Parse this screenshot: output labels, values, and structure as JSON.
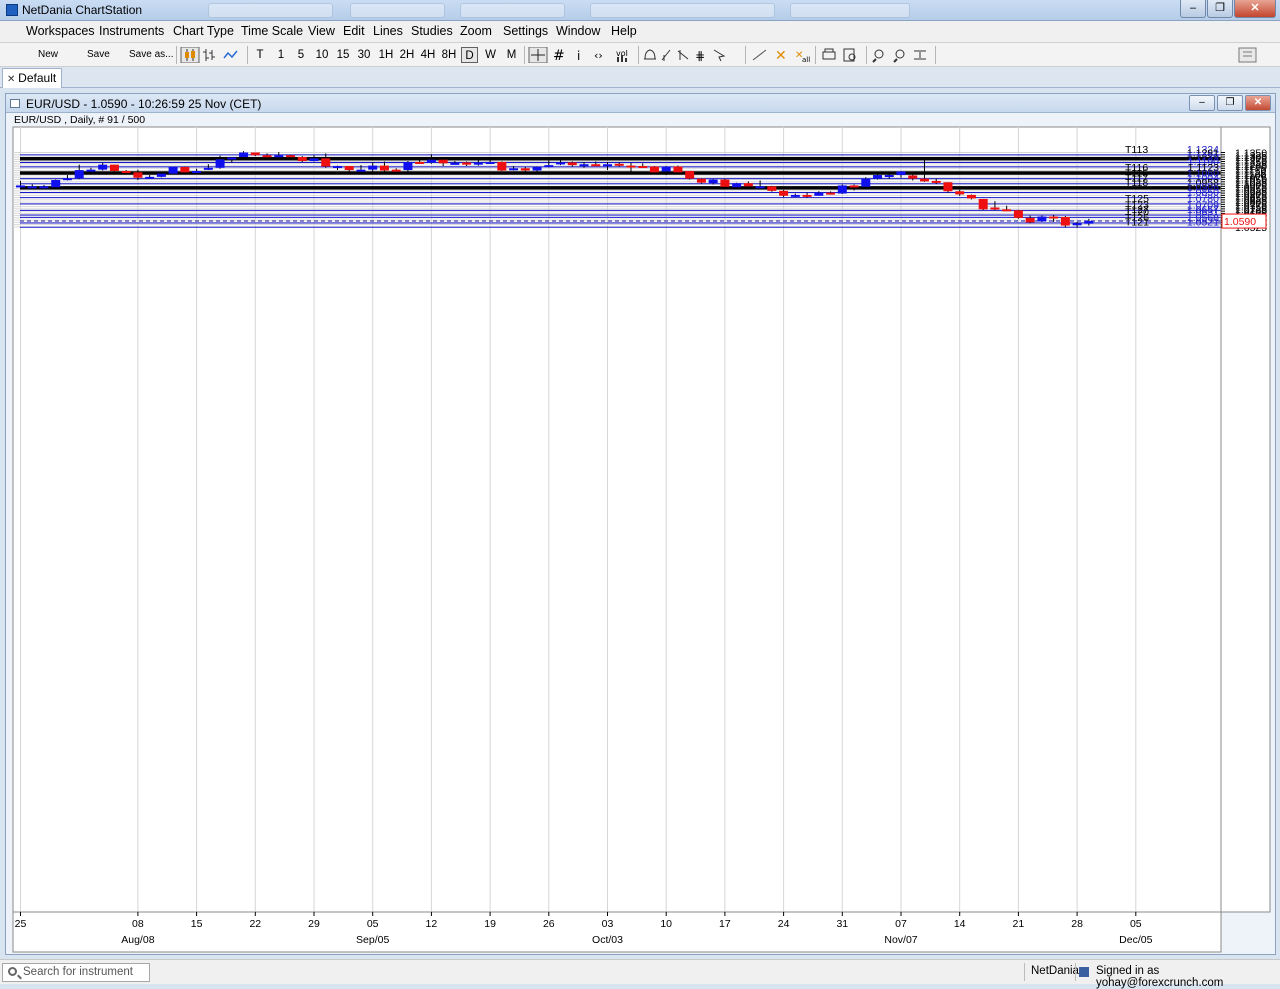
{
  "window": {
    "title": "NetDania ChartStation",
    "controls": [
      "–",
      "❐",
      "✕"
    ]
  },
  "menu": [
    "Workspaces",
    "Instruments",
    "Chart Type",
    "Time Scale",
    "View",
    "Edit",
    "Lines",
    "Studies",
    "Zoom",
    "Settings",
    "Window",
    "Help"
  ],
  "toolbar": {
    "new": "New",
    "save": "Save",
    "save_as": "Save as...",
    "timeframes": [
      "T",
      "1",
      "5",
      "10",
      "15",
      "30",
      "1H",
      "2H",
      "4H",
      "8H",
      "D",
      "W",
      "M"
    ],
    "selected_timeframe": "D",
    "vol_label": "vol"
  },
  "tab": {
    "label": "Default"
  },
  "chart_window": {
    "title": "EUR/USD - 1.0590 - 10:26:59  25 Nov (CET)",
    "subtitle": "EUR/USD , Daily, # 91 / 500"
  },
  "status": {
    "search_placeholder": "Search for instrument",
    "provider": "NetDania",
    "signed_in": "Signed in as yohay@forexcrunch.com"
  },
  "chart_data": {
    "type": "candlestick",
    "instrument": "EUR/USD",
    "timeframe": "Daily",
    "ylim": [
      1.051,
      1.137
    ],
    "y_ticks": [
      "1.1350",
      "1.1325",
      "1.1300",
      "1.1275",
      "1.1250",
      "1.1225",
      "1.1200",
      "1.1175",
      "1.1150",
      "1.1125",
      "1.1100",
      "1.1075",
      "1.1050",
      "1.1025",
      "1.1000",
      "1.0975",
      "1.0950",
      "1.0925",
      "1.0900",
      "1.0875",
      "1.0850",
      "1.0825",
      "1.0800",
      "1.0775",
      "1.0750",
      "1.0725",
      "1.0700",
      "1.0675",
      "1.0650",
      "1.0625",
      "1.0600",
      "1.0575",
      "1.0550",
      "1.0525"
    ],
    "x_ticks": [
      {
        "label": "25",
        "sub": "",
        "index": 0
      },
      {
        "label": "08",
        "sub": "Aug/08",
        "index": 10
      },
      {
        "label": "15",
        "sub": "",
        "index": 15
      },
      {
        "label": "22",
        "sub": "",
        "index": 20
      },
      {
        "label": "29",
        "sub": "",
        "index": 25
      },
      {
        "label": "05",
        "sub": "Sep/05",
        "index": 30
      },
      {
        "label": "12",
        "sub": "",
        "index": 35
      },
      {
        "label": "19",
        "sub": "",
        "index": 40
      },
      {
        "label": "26",
        "sub": "",
        "index": 45
      },
      {
        "label": "03",
        "sub": "Oct/03",
        "index": 50
      },
      {
        "label": "10",
        "sub": "",
        "index": 55
      },
      {
        "label": "17",
        "sub": "",
        "index": 60
      },
      {
        "label": "24",
        "sub": "",
        "index": 65
      },
      {
        "label": "31",
        "sub": "",
        "index": 70
      },
      {
        "label": "07",
        "sub": "Nov/07",
        "index": 75
      },
      {
        "label": "14",
        "sub": "",
        "index": 80
      },
      {
        "label": "21",
        "sub": "",
        "index": 85
      },
      {
        "label": "28",
        "sub": "",
        "index": 90
      },
      {
        "label": "05",
        "sub": "Dec/05",
        "index": 95
      }
    ],
    "last_price": "1.0590",
    "colors": {
      "up": "#1010ee",
      "down": "#ee1010",
      "level": "#1a1acc",
      "thick": "#000000"
    },
    "levels": [
      {
        "tag": "T113",
        "value": "1.1324",
        "thick": false
      },
      {
        "tag": "",
        "value": "1.1281",
        "thick": true
      },
      {
        "tag": "",
        "value": "1.1239",
        "thick": false
      },
      {
        "tag": "",
        "value": "1.1190",
        "thick": false
      },
      {
        "tag": "T116",
        "value": "1.1123",
        "thick": true
      },
      {
        "tag": "T115",
        "value": "1.1060",
        "thick": false
      },
      {
        "tag": "T117",
        "value": "1.1004",
        "thick": false
      },
      {
        "tag": "T118",
        "value": "1.0958",
        "thick": true
      },
      {
        "tag": "",
        "value": "1.0906",
        "thick": false
      },
      {
        "tag": "",
        "value": "1.0850",
        "thick": false
      },
      {
        "tag": "T125",
        "value": "1.0780",
        "thick": false
      },
      {
        "tag": "T123",
        "value": "1.0709",
        "thick": false
      },
      {
        "tag": "T127",
        "value": "1.0657",
        "thick": false
      },
      {
        "tag": "T120",
        "value": "1.0631",
        "thick": false
      },
      {
        "tag": "T126",
        "value": "1.0568",
        "thick": false
      },
      {
        "tag": "T121",
        "value": "1.0521",
        "thick": false
      }
    ],
    "candles": [
      [
        1.0975,
        1.0985,
        1.0955,
        1.1035
      ],
      [
        1.0955,
        1.0975,
        1.095,
        1.0998
      ],
      [
        1.097,
        1.0975,
        1.0965,
        1.099
      ],
      [
        1.0965,
        1.1045,
        1.0955,
        1.105
      ],
      [
        1.105,
        1.1065,
        1.104,
        1.11
      ],
      [
        1.1065,
        1.1155,
        1.1055,
        1.1215
      ],
      [
        1.116,
        1.116,
        1.115,
        1.118
      ],
      [
        1.116,
        1.1215,
        1.115,
        1.1235
      ],
      [
        1.1215,
        1.1145,
        1.114,
        1.1215
      ],
      [
        1.1145,
        1.113,
        1.111,
        1.1155
      ],
      [
        1.113,
        1.107,
        1.1045,
        1.116
      ],
      [
        1.108,
        1.108,
        1.1065,
        1.11
      ],
      [
        1.108,
        1.1115,
        1.1075,
        1.113
      ],
      [
        1.1115,
        1.119,
        1.111,
        1.119
      ],
      [
        1.119,
        1.113,
        1.112,
        1.1195
      ],
      [
        1.1135,
        1.1145,
        1.1125,
        1.117
      ],
      [
        1.116,
        1.118,
        1.1155,
        1.122
      ],
      [
        1.118,
        1.1275,
        1.117,
        1.1315
      ],
      [
        1.1275,
        1.1295,
        1.124,
        1.1295
      ],
      [
        1.13,
        1.135,
        1.1295,
        1.1365
      ],
      [
        1.135,
        1.132,
        1.131,
        1.135
      ],
      [
        1.132,
        1.13,
        1.127,
        1.134
      ],
      [
        1.1305,
        1.132,
        1.1295,
        1.1355
      ],
      [
        1.132,
        1.13,
        1.1295,
        1.1325
      ],
      [
        1.13,
        1.1255,
        1.1245,
        1.131
      ],
      [
        1.1255,
        1.1285,
        1.125,
        1.132
      ],
      [
        1.1285,
        1.1195,
        1.118,
        1.134
      ],
      [
        1.1195,
        1.12,
        1.1155,
        1.1205
      ],
      [
        1.12,
        1.1155,
        1.113,
        1.12
      ],
      [
        1.115,
        1.116,
        1.1125,
        1.121
      ],
      [
        1.116,
        1.1205,
        1.113,
        1.1245
      ],
      [
        1.1205,
        1.115,
        1.1135,
        1.125
      ],
      [
        1.116,
        1.1155,
        1.1145,
        1.1175
      ],
      [
        1.1155,
        1.1245,
        1.114,
        1.1255
      ],
      [
        1.1245,
        1.124,
        1.123,
        1.1275
      ],
      [
        1.1235,
        1.127,
        1.1225,
        1.133
      ],
      [
        1.127,
        1.123,
        1.12,
        1.1285
      ],
      [
        1.123,
        1.1235,
        1.1225,
        1.1255
      ],
      [
        1.124,
        1.1215,
        1.12,
        1.125
      ],
      [
        1.1215,
        1.124,
        1.1205,
        1.1275
      ],
      [
        1.124,
        1.1245,
        1.1235,
        1.1285
      ],
      [
        1.1245,
        1.115,
        1.1145,
        1.125
      ],
      [
        1.1155,
        1.1175,
        1.115,
        1.12
      ],
      [
        1.1175,
        1.115,
        1.114,
        1.119
      ],
      [
        1.115,
        1.119,
        1.1125,
        1.1195
      ],
      [
        1.119,
        1.121,
        1.1185,
        1.126
      ],
      [
        1.1225,
        1.124,
        1.121,
        1.1285
      ],
      [
        1.124,
        1.121,
        1.1195,
        1.125
      ],
      [
        1.121,
        1.122,
        1.118,
        1.1245
      ],
      [
        1.122,
        1.1215,
        1.12,
        1.125
      ],
      [
        1.1215,
        1.122,
        1.1155,
        1.1245
      ],
      [
        1.1225,
        1.1205,
        1.1195,
        1.124
      ],
      [
        1.1205,
        1.12,
        1.1135,
        1.1235
      ],
      [
        1.12,
        1.1195,
        1.1195,
        1.123
      ],
      [
        1.1195,
        1.113,
        1.1115,
        1.12
      ],
      [
        1.114,
        1.1195,
        1.11,
        1.12
      ],
      [
        1.1195,
        1.113,
        1.1125,
        1.1205
      ],
      [
        1.1145,
        1.106,
        1.105,
        1.1145
      ],
      [
        1.106,
        1.1015,
        1.1005,
        1.1065
      ],
      [
        1.101,
        1.105,
        1.0995,
        1.1055
      ],
      [
        1.105,
        1.097,
        1.0965,
        1.106
      ],
      [
        1.0965,
        1.101,
        1.0965,
        1.1015
      ],
      [
        1.101,
        1.0975,
        1.097,
        1.103
      ],
      [
        1.0975,
        1.0975,
        1.0955,
        1.104
      ],
      [
        1.0975,
        1.0925,
        1.0915,
        1.098
      ],
      [
        1.0925,
        1.087,
        1.0855,
        1.0935
      ],
      [
        1.087,
        1.088,
        1.0855,
        1.0895
      ],
      [
        1.088,
        1.0868,
        1.0848,
        1.0905
      ],
      [
        1.087,
        1.0905,
        1.087,
        1.092
      ],
      [
        1.0905,
        1.0895,
        1.0883,
        1.0918
      ],
      [
        1.0895,
        1.0985,
        1.089,
        1.0995
      ],
      [
        1.0985,
        1.097,
        1.093,
        1.0995
      ],
      [
        1.097,
        1.106,
        1.096,
        1.1075
      ],
      [
        1.106,
        1.11,
        1.105,
        1.1135
      ],
      [
        1.1095,
        1.11,
        1.106,
        1.1125
      ],
      [
        1.11,
        1.114,
        1.107,
        1.1145
      ],
      [
        1.1095,
        1.106,
        1.104,
        1.1115
      ],
      [
        1.106,
        1.103,
        1.1025,
        1.13
      ],
      [
        1.1035,
        1.102,
        1.1,
        1.106
      ],
      [
        1.102,
        1.092,
        1.0905,
        1.102
      ],
      [
        1.092,
        1.0885,
        1.087,
        1.0935
      ],
      [
        1.088,
        1.084,
        1.083,
        1.0885
      ],
      [
        1.0835,
        1.072,
        1.071,
        1.0835
      ],
      [
        1.074,
        1.072,
        1.071,
        1.081
      ],
      [
        1.072,
        1.0715,
        1.07,
        1.076
      ],
      [
        1.071,
        1.0625,
        1.0615,
        1.0715
      ],
      [
        1.0625,
        1.0575,
        1.0565,
        1.065
      ],
      [
        1.0585,
        1.064,
        1.058,
        1.065
      ],
      [
        1.064,
        1.0635,
        1.058,
        1.066
      ],
      [
        1.0635,
        1.054,
        1.052,
        1.0645
      ],
      [
        1.0545,
        1.0565,
        1.0518,
        1.058
      ],
      [
        1.056,
        1.059,
        1.054,
        1.0615
      ]
    ]
  }
}
